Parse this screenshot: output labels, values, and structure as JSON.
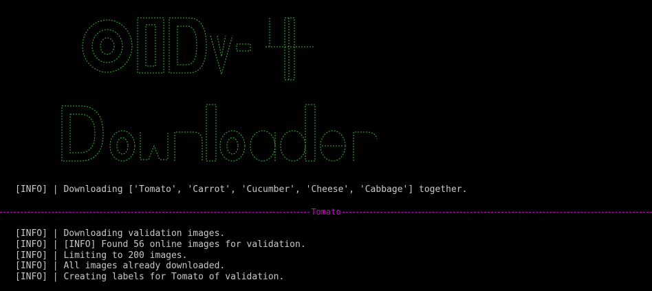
{
  "banner": {
    "line1": "OIDv4",
    "line2": "Downloader",
    "color": "#30c030"
  },
  "info_line": "[INFO] | Downloading ['Tomato', 'Carrot', 'Cucumber', 'Cheese', 'Cabbage'] together.",
  "separator": {
    "label": "Tomato",
    "color": "#d000d0"
  },
  "logs": [
    "[INFO] | Downloading validation images.",
    "[INFO] | [INFO] Found 56 online images for validation.",
    "[INFO] | Limiting to 200 images.",
    "[INFO] | All images already downloaded.",
    "[INFO] | Creating labels for Tomato of validation."
  ]
}
